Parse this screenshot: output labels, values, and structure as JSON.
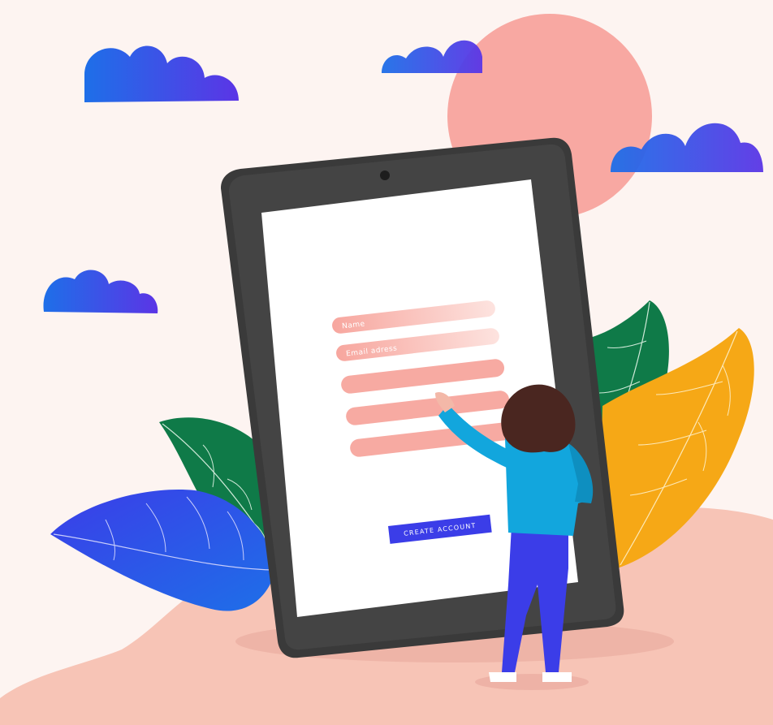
{
  "form": {
    "fields": [
      {
        "placeholder": "Name"
      },
      {
        "placeholder": "Email adress"
      },
      {
        "placeholder": ""
      },
      {
        "placeholder": ""
      },
      {
        "placeholder": ""
      }
    ],
    "submit_label": "CREATE ACCOUNT"
  },
  "colors": {
    "background": "#fdf4f1",
    "sun": "#f8a8a2",
    "ground": "#f7c4b6",
    "cloud_gradient": [
      "#1e6fe8",
      "#5b35e6"
    ],
    "tablet_frame": "#3a3a3a",
    "screen": "#ffffff",
    "field": "#f7a69e",
    "button": "#3b3de8",
    "leaf_green": "#0f7a48",
    "leaf_yellow": "#f6a816",
    "leaf_blue": "#4047e8",
    "shirt": "#12a6dd",
    "pants": "#3b3de8",
    "hair": "#4a2620"
  },
  "icons": [
    "cloud-icon",
    "sun-icon",
    "camera-icon",
    "leaf-icon",
    "person-icon"
  ]
}
